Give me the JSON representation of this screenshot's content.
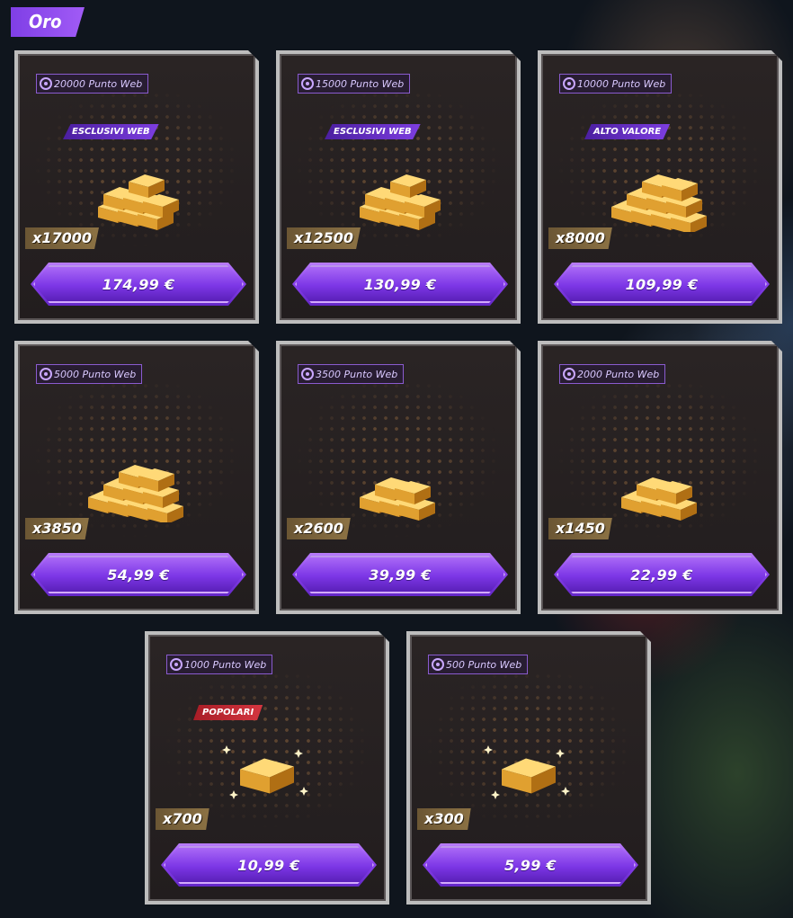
{
  "section": {
    "title": "Oro"
  },
  "cards": [
    {
      "web_points": "20000 Punto Web",
      "tag": "ESCLUSIVI WEB",
      "tag_color": "purple",
      "quantity": "x17000",
      "price": "174,99 €"
    },
    {
      "web_points": "15000 Punto Web",
      "tag": "ESCLUSIVI WEB",
      "tag_color": "purple",
      "quantity": "x12500",
      "price": "130,99 €"
    },
    {
      "web_points": "10000 Punto Web",
      "tag": "ALTO VALORE",
      "tag_color": "purple",
      "quantity": "x8000",
      "price": "109,99 €"
    },
    {
      "web_points": "5000 Punto Web",
      "tag": "",
      "quantity": "x3850",
      "price": "54,99 €"
    },
    {
      "web_points": "3500 Punto Web",
      "tag": "",
      "quantity": "x2600",
      "price": "39,99 €"
    },
    {
      "web_points": "2000 Punto Web",
      "tag": "",
      "quantity": "x1450",
      "price": "22,99 €"
    },
    {
      "web_points": "1000 Punto Web",
      "tag": "POPOLARI",
      "tag_color": "red",
      "quantity": "x700",
      "price": "10,99 €"
    },
    {
      "web_points": "500 Punto Web",
      "tag": "",
      "quantity": "x300",
      "price": "5,99 €"
    }
  ],
  "colors": {
    "accent": "#8b43ee",
    "gold": "#e6a93a",
    "tag_red": "#c22a33"
  },
  "icons": {
    "web_point": "web-point-icon",
    "gold": "gold-bars-icon"
  }
}
